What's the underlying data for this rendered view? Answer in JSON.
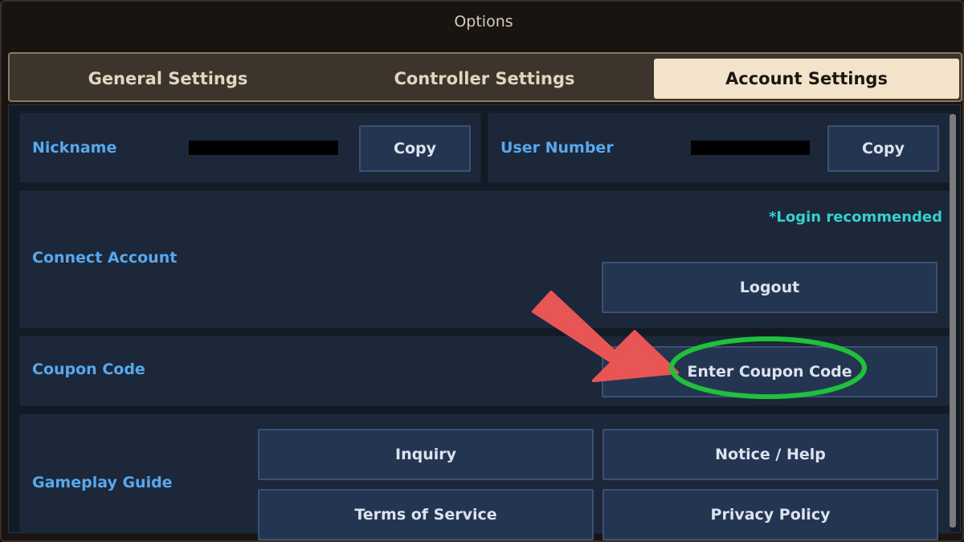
{
  "window": {
    "title": "Options"
  },
  "tabs": [
    {
      "label": "General Settings"
    },
    {
      "label": "Controller Settings"
    },
    {
      "label": "Account Settings",
      "active": true
    }
  ],
  "nickname": {
    "label": "Nickname",
    "value": "",
    "copy_label": "Copy"
  },
  "user_number": {
    "label": "User Number",
    "value": "",
    "copy_label": "Copy"
  },
  "connect_account": {
    "label": "Connect Account",
    "note": "*Login recommended",
    "logout_label": "Logout"
  },
  "coupon": {
    "label": "Coupon Code",
    "button_label": "Enter Coupon Code"
  },
  "gameplay_guide": {
    "label": "Gameplay Guide",
    "buttons": {
      "inquiry": "Inquiry",
      "notice_help": "Notice / Help",
      "terms": "Terms of Service",
      "privacy": "Privacy Policy"
    }
  },
  "annotations": {
    "arrow_color": "#e85555",
    "highlight_color": "#1fc13a"
  }
}
